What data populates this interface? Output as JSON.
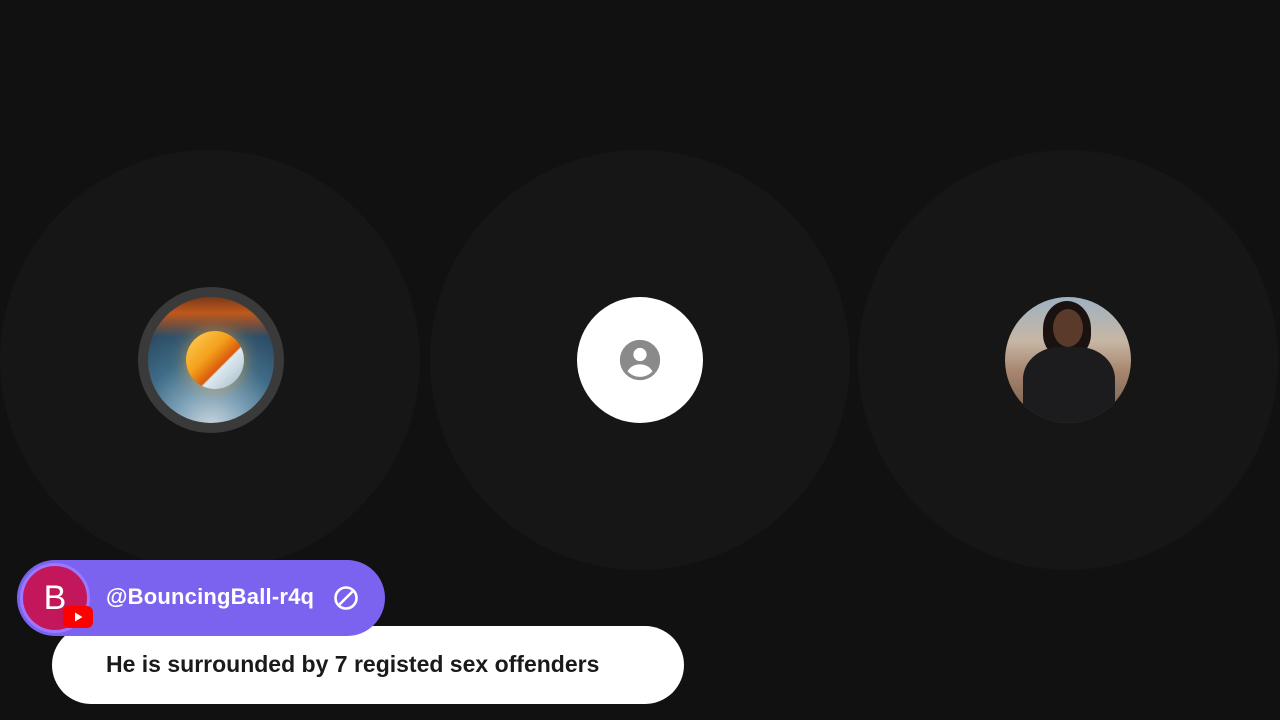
{
  "participants": [
    {
      "id": "left",
      "avatar": "fire-ice-globe",
      "speaking": true
    },
    {
      "id": "center",
      "avatar": "default-account-icon",
      "speaking": false
    },
    {
      "id": "right",
      "avatar": "woman-in-leather-jacket-portrait",
      "speaking": false
    }
  ],
  "chat": {
    "author": {
      "initial": "B",
      "handle": "@BouncingBall-r4q",
      "avatar_color": "#c2185b",
      "badge": "youtube-icon"
    },
    "message": "He is surrounded by 7 registed sex offenders",
    "action_icon": "block-icon"
  },
  "colors": {
    "background": "#111111",
    "slot": "#161616",
    "author_pill": "#7b63f0",
    "message_pill": "#ffffff"
  }
}
